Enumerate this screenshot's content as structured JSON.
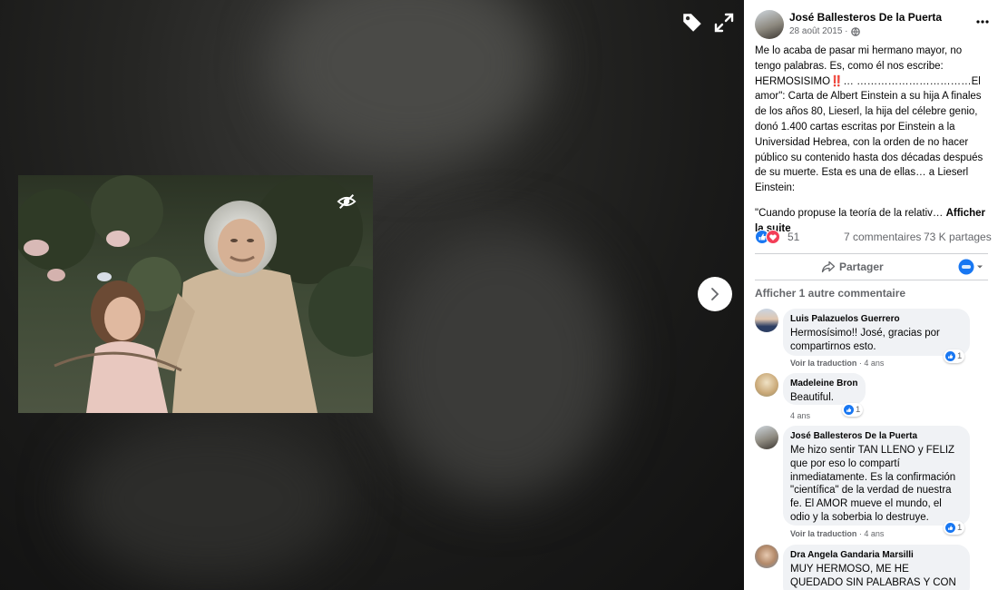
{
  "viewer": {
    "photo_alt": "",
    "next_label": "›"
  },
  "post": {
    "author": "José Ballesteros De la Puerta",
    "date": "28 août 2015 ·",
    "text_paragraph_1": "Me lo acaba de pasar mi hermano mayor, no tengo palabras. Es, como él nos escribe: HERMOSISIMO‼️… ……………………………El amor\": Carta de Albert Einstein a su hija A finales de los años 80, Lieserl, la hija del célebre genio, donó 1.400 cartas escritas por Einstein a la Universidad Hebrea, con la orden de no hacer público su contenido hasta dos décadas después de su muerte. Esta es una de ellas… a Lieserl Einstein:",
    "text_paragraph_2": "\"Cuando propuse la teoría de la relativ…",
    "see_more": "Afficher la suite"
  },
  "stats": {
    "reactions": "51",
    "comments": "7 commentaires",
    "shares": "73 K partages"
  },
  "actions": {
    "share": "Partager",
    "more_comments": "Afficher 1 autre commentaire"
  },
  "comments": [
    {
      "author": "Luis Palazuelos Guerrero",
      "text": "Hermosísimo!! José, gracias por compartirnos esto.",
      "translate": "Voir la traduction",
      "time": "· 4 ans",
      "likes": "1"
    },
    {
      "author": "Madeleine Bron",
      "text": "Beautiful.",
      "translate": "",
      "time": "4 ans",
      "likes": "1"
    },
    {
      "author": "José Ballesteros De la Puerta",
      "text": "Me hizo sentir TAN LLENO y FELIZ que por eso lo compartí inmediatamente. Es la confirmación \"científica\" de la verdad de nuestra fe. El AMOR mueve el mundo, el odio y la soberbia lo destruye.",
      "translate": "Voir la traduction",
      "time": "· 4 ans",
      "likes": "1"
    },
    {
      "author": "Dra Angela Gandaria Marsilli",
      "text": "MUY HERMOSO, ME HE QUEDADO SIN PALABRAS Y CON MUCHA",
      "translate": "",
      "time": "",
      "likes": ""
    }
  ],
  "colors": {
    "like_blue": "#1877f2",
    "love_red": "#f33e58",
    "muted_text": "#65676b",
    "bubble_bg": "#f0f2f5"
  }
}
